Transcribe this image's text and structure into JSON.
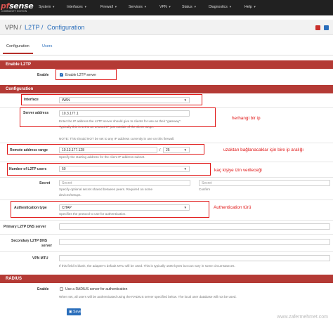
{
  "brand": {
    "logo_main": "pfsense",
    "logo_tag": "COMMUNITY EDITION"
  },
  "nav": {
    "items": [
      {
        "label": "System"
      },
      {
        "label": "Interfaces"
      },
      {
        "label": "Firewall"
      },
      {
        "label": "Services"
      },
      {
        "label": "VPN"
      },
      {
        "label": "Status"
      },
      {
        "label": "Diagnostics"
      },
      {
        "label": "Help"
      }
    ]
  },
  "breadcrumb": {
    "vpn": "VPN /",
    "l2tp": "L2TP /",
    "config": "Configuration"
  },
  "tabs": [
    {
      "label": "Configuration"
    },
    {
      "label": "Users"
    }
  ],
  "enable_l2tp": {
    "header": "Enable L2TP",
    "label": "Enable",
    "checkbox_label": "Enable L2TP server",
    "checked": true
  },
  "configuration": {
    "header": "Configuration",
    "interface": {
      "label": "Interface",
      "value": "WAN"
    },
    "server_address": {
      "label": "Server address",
      "value": "10.3.177.1",
      "help1": "Enter the IP address the L2TP server should give to clients for use as their \"gateway\".",
      "help2": "Typically this is set to an unused IP just outside of the client range.",
      "help3": "NOTE: This should NOT be set to any IP address currently in use on this firewall."
    },
    "remote_range": {
      "label": "Remote address range",
      "value": "10.13.177.128",
      "mask": "25",
      "separator": "/",
      "help": "Specify the starting address for the client IP address subnet."
    },
    "num_users": {
      "label": "Number of L2TP users",
      "value": "50"
    },
    "secret": {
      "label": "Secret",
      "placeholder": "Secret",
      "confirm_placeholder": "Secret",
      "confirm_label": "Confirm",
      "help1": "Specify optional secret shared between peers. Required on some",
      "help2": "devices/setups."
    },
    "auth_type": {
      "label": "Authentication type",
      "value": "CHAP",
      "help": "Specifies the protocol to use for authentication."
    },
    "primary_dns": {
      "label": "Primary L2TP DNS server"
    },
    "secondary_dns": {
      "label1": "Secondary L2TP DNS",
      "label2": "server"
    },
    "vpn_mtu": {
      "label": "VPN MTU",
      "help": "If this field is blank, the adapter's default MTU will be used. This is typically 1500 bytes but can vary in some circumstances."
    }
  },
  "radius": {
    "header": "RADIUS",
    "label": "Enable",
    "checkbox_label": "Use a RADIUS server for authentication",
    "help": "When set, all users will be authenticated using the RADIUS server specified below. The local user database will not be used.",
    "checked": false
  },
  "save_label": "Save",
  "annotations": {
    "server": "herhangi bir ip",
    "range": "uzaktan bağlanacaklar için bire ip aralığı",
    "users": "kaç kişiye izin verileceği",
    "auth": "Authentication türü"
  },
  "watermark": "www.zafermehmet.com",
  "colors": {
    "navbar": "#212121",
    "panel_header": "#b43a35",
    "link": "#2a6ebb",
    "annotation": "#e01818"
  }
}
